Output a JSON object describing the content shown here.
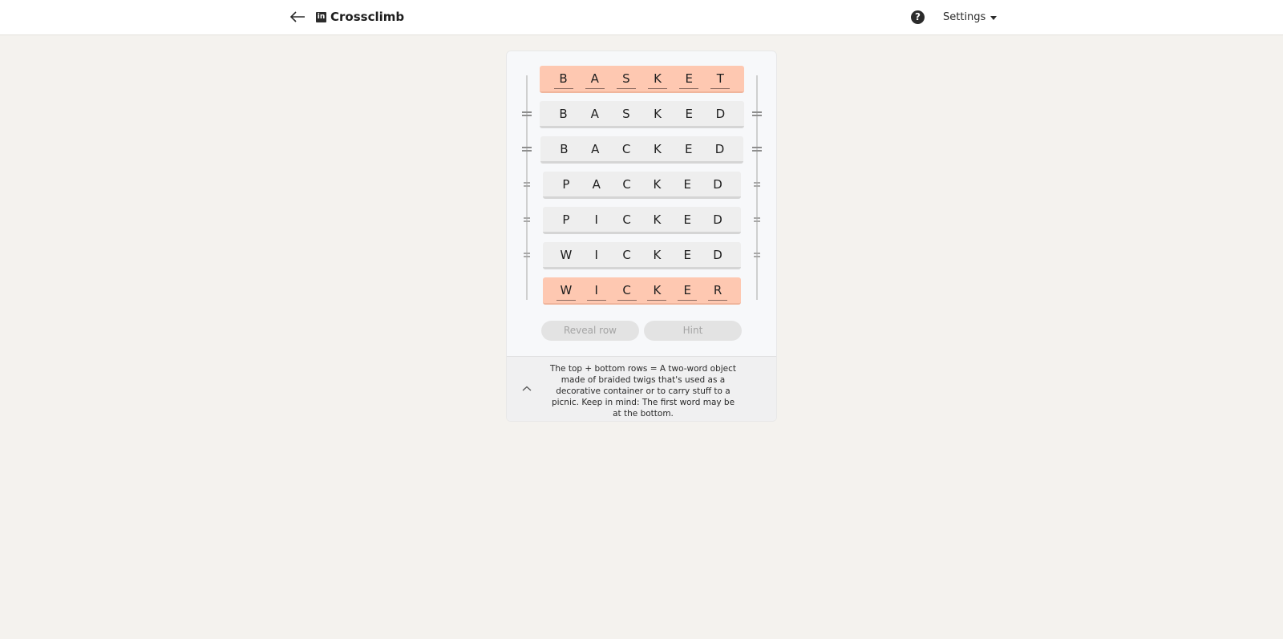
{
  "header": {
    "back_icon": "arrow-left-icon",
    "logo_text": "in",
    "title": "Crossclimb",
    "help_symbol": "?",
    "settings_label": "Settings"
  },
  "puzzle": {
    "rows": [
      {
        "letters": [
          "B",
          "A",
          "S",
          "K",
          "E",
          "T"
        ],
        "kind": "end"
      },
      {
        "letters": [
          "B",
          "A",
          "S",
          "K",
          "E",
          "D"
        ],
        "kind": "middle"
      },
      {
        "letters": [
          "B",
          "A",
          "C",
          "K",
          "E",
          "D"
        ],
        "kind": "middle"
      },
      {
        "letters": [
          "P",
          "A",
          "C",
          "K",
          "E",
          "D"
        ],
        "kind": "middle"
      },
      {
        "letters": [
          "P",
          "I",
          "C",
          "K",
          "E",
          "D"
        ],
        "kind": "middle"
      },
      {
        "letters": [
          "W",
          "I",
          "C",
          "K",
          "E",
          "D"
        ],
        "kind": "middle"
      },
      {
        "letters": [
          "W",
          "I",
          "C",
          "K",
          "E",
          "R"
        ],
        "kind": "end"
      }
    ],
    "end_row_color": "#fec8b1",
    "middle_row_color": "#eeeeee"
  },
  "actions": {
    "reveal_label": "Reveal row",
    "hint_label": "Hint"
  },
  "clue": {
    "text": "The top + bottom rows = A two-word object made of braided twigs that's used as a decorative container or to carry stuff to a picnic. Keep in mind: The first word may be at the bottom."
  }
}
